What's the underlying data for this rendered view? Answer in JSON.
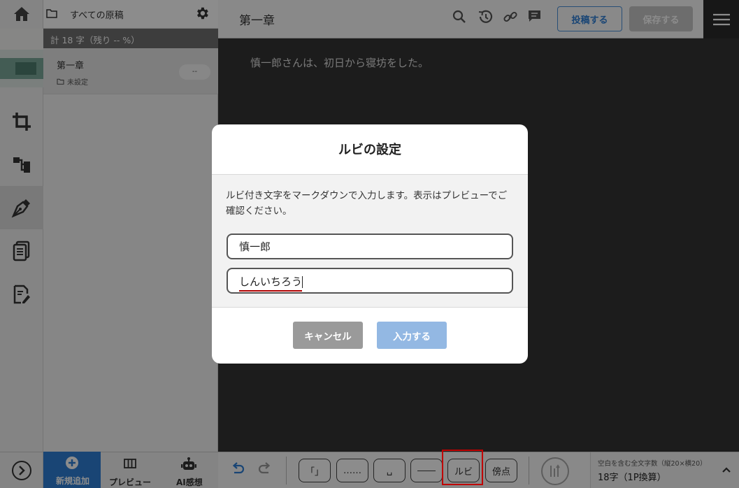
{
  "app": {
    "home_icon": "home-icon",
    "menu_icon": "hamburger-menu-icon"
  },
  "list_panel": {
    "header_title": "すべての原稿",
    "count_text": "計 18 字（残り -- %）",
    "doc_item": {
      "title": "第一章",
      "folder": "未設定",
      "pill": "--"
    }
  },
  "toolbar": {
    "doc_title": "第一章",
    "post_label": "投稿する",
    "save_label": "保存する"
  },
  "editor": {
    "text": "慎一郎さんは、初日から寝坊をした。"
  },
  "bottom_left": {
    "new_label": "新規追加",
    "preview_label": "プレビュー",
    "ai_label": "AI感想"
  },
  "bottom_toolbar": {
    "keys": [
      "「」",
      "……",
      "␣",
      "――",
      "ルビ",
      "傍点"
    ],
    "stat_label": "空白を含む全文字数（縦20×横20）",
    "stat_value": "18字（1P換算）"
  },
  "dialog": {
    "title": "ルビの設定",
    "description": "ルビ付き文字をマークダウンで入力します。表示はプレビューでご確認ください。",
    "base_value": "慎一郎",
    "ruby_value": "しんいちろう",
    "cancel_label": "キャンセル",
    "submit_label": "入力する"
  },
  "colors": {
    "accent_blue": "#2f7fd5",
    "submit_blue": "#93b8e3",
    "cancel_gray": "#9a9a9a",
    "highlight_red": "#c00000",
    "ime_underline": "#b00000"
  }
}
